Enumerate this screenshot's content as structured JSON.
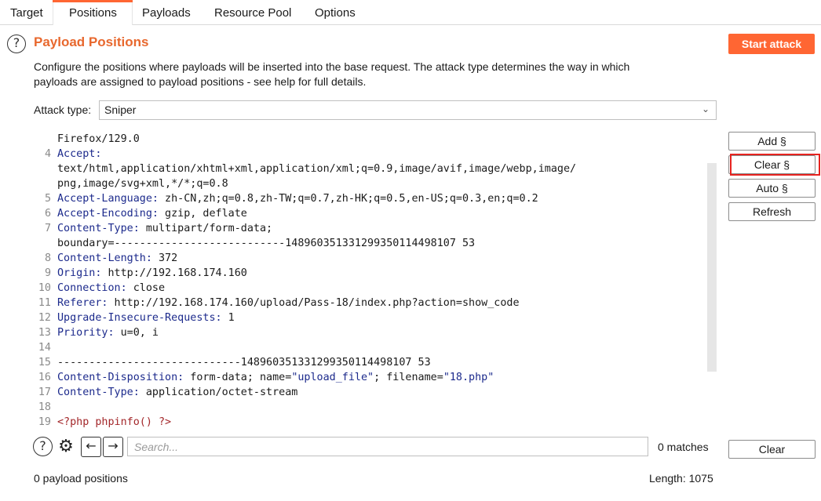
{
  "tabs": [
    {
      "label": "Target"
    },
    {
      "label": "Positions"
    },
    {
      "label": "Payloads"
    },
    {
      "label": "Resource Pool"
    },
    {
      "label": "Options"
    }
  ],
  "active_tab": "Positions",
  "accent_color": "#ff6633",
  "section": {
    "title": "Payload Positions",
    "help_icon": "help-circle-icon",
    "description_line1": "Configure the positions where payloads will be inserted into the base request. The attack type determines the way in which",
    "description_line2": "payloads are assigned to payload positions - see help for full details."
  },
  "toolbar": {
    "start_attack": "Start attack"
  },
  "attack_type": {
    "label": "Attack type:",
    "value": "Sniper"
  },
  "side_buttons": {
    "add": "Add §",
    "clear": "Clear §",
    "auto": "Auto §",
    "refresh": "Refresh",
    "clear_search": "Clear"
  },
  "editor": {
    "lines": [
      {
        "num": "",
        "key": "",
        "value": "Firefox/129.0"
      },
      {
        "num": "4",
        "key": "Accept:",
        "value": ""
      },
      {
        "num": "",
        "key": "",
        "value": "text/html,application/xhtml+xml,application/xml;q=0.9,image/avif,image/webp,image/"
      },
      {
        "num": "",
        "key": "",
        "value": "png,image/svg+xml,*/*;q=0.8"
      },
      {
        "num": "5",
        "key": "Accept-Language:",
        "value": " zh-CN,zh;q=0.8,zh-TW;q=0.7,zh-HK;q=0.5,en-US;q=0.3,en;q=0.2"
      },
      {
        "num": "6",
        "key": "Accept-Encoding:",
        "value": " gzip, deflate"
      },
      {
        "num": "7",
        "key": "Content-Type:",
        "value": " multipart/form-data;"
      },
      {
        "num": "",
        "key": "",
        "value": "boundary=---------------------------148960351331299350114498107 53"
      },
      {
        "num": "8",
        "key": "Content-Length:",
        "value": " 372"
      },
      {
        "num": "9",
        "key": "Origin:",
        "value": " http://192.168.174.160"
      },
      {
        "num": "10",
        "key": "Connection:",
        "value": " close"
      },
      {
        "num": "11",
        "key": "Referer:",
        "value": " http://192.168.174.160/upload/Pass-18/index.php?action=show_code"
      },
      {
        "num": "12",
        "key": "Upgrade-Insecure-Requests:",
        "value": " 1"
      },
      {
        "num": "13",
        "key": "Priority:",
        "value": " u=0, i"
      },
      {
        "num": "14",
        "key": "",
        "value": ""
      },
      {
        "num": "15",
        "key": "",
        "value": "-----------------------------148960351331299350114498107 53"
      },
      {
        "num": "16",
        "key": "Content-Disposition:",
        "value": " form-data; name=",
        "s1": "\"upload_file\"",
        "mid": "; filename=",
        "s2": "\"18.php\""
      },
      {
        "num": "17",
        "key": "Content-Type:",
        "value": " application/octet-stream"
      },
      {
        "num": "18",
        "key": "",
        "value": ""
      },
      {
        "num": "19",
        "key": "",
        "value": "",
        "php": "<?php phpinfo() ?>"
      }
    ]
  },
  "search": {
    "placeholder": "Search...",
    "matches": "0 matches"
  },
  "status": {
    "positions": "0 payload positions",
    "length": "Length: 1075"
  }
}
